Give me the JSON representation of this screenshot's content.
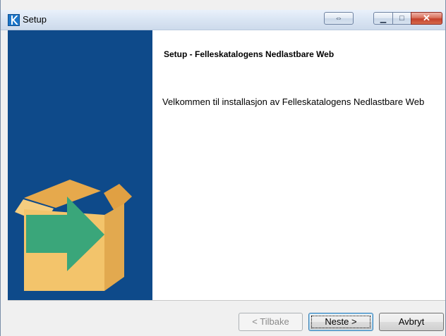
{
  "window": {
    "title": "Setup",
    "controls": {
      "resize_glyph": "⇔",
      "minimize_glyph": "▁",
      "maximize_glyph": "□",
      "close_glyph": "✕"
    }
  },
  "content": {
    "heading": "Setup - Felleskatalogens Nedlastbare Web",
    "welcome": "Velkommen til installasjon av Felleskatalogens Nedlastbare Web"
  },
  "buttons": {
    "back": "< Tilbake",
    "next": "Neste >",
    "cancel": "Avbryt"
  },
  "colors": {
    "banner": "#0e4a8a",
    "box": "#f3c46b",
    "arrow": "#3aa67a"
  },
  "icons": {
    "app": "felleskatalogen-k-icon",
    "banner": "box-arrow-icon"
  }
}
